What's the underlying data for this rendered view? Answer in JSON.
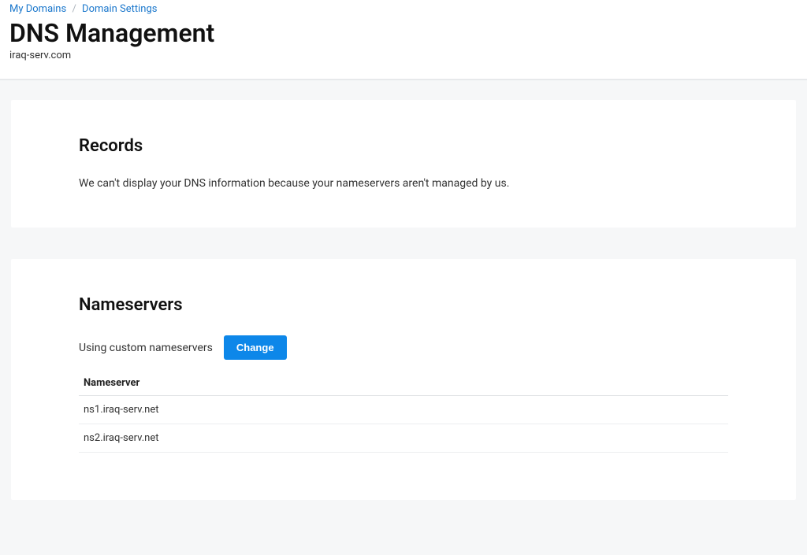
{
  "breadcrumb": {
    "items": [
      {
        "label": "My Domains"
      },
      {
        "label": "Domain Settings"
      }
    ]
  },
  "header": {
    "title": "DNS Management",
    "subtitle": "iraq-serv.com"
  },
  "records": {
    "section_title": "Records",
    "note": "We can't display your DNS information because your nameservers aren't managed by us."
  },
  "nameservers": {
    "section_title": "Nameservers",
    "status_text": "Using custom nameservers",
    "change_label": "Change",
    "column_header": "Nameserver",
    "rows": [
      "ns1.iraq-serv.net",
      "ns2.iraq-serv.net"
    ]
  }
}
